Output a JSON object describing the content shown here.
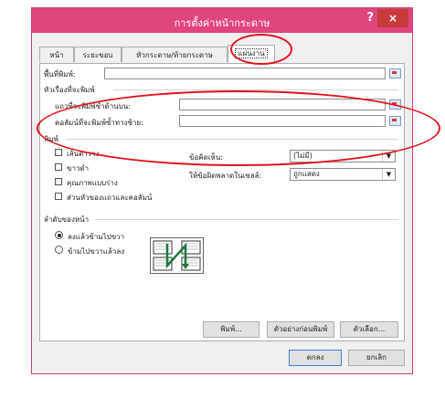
{
  "dialog": {
    "title": "การตั้งค่าหน้ากระดาษ",
    "help": "?",
    "close": "×"
  },
  "tabs": [
    {
      "label": "หน้า"
    },
    {
      "label": "ระยะขอบ"
    },
    {
      "label": "หัวกระดาษ/ท้ายกระดาษ"
    },
    {
      "label": "แผ่นงาน"
    }
  ],
  "sheet": {
    "print_area_label": "พื้นที่พิมพ์:",
    "print_titles_section": "หัวเรื่องที่จะพิมพ์",
    "rows_repeat_label": "แถวที่จะพิมพ์ซ้ำด้านบน:",
    "cols_repeat_label": "คอลัมน์ที่จะพิมพ์ซ้ำทางซ้าย:",
    "print_section": "พิมพ์",
    "checkboxes": [
      {
        "label": "เส้นตาราง"
      },
      {
        "label": "ขาวดำ"
      },
      {
        "label": "คุณภาพแบบร่าง"
      },
      {
        "label": "ส่วนหัวของแถวและคอลัมน์"
      }
    ],
    "comments_label": "ข้อคิดเห็น:",
    "comments_value": "(ไม่มี)",
    "errors_label": "ให้ข้อผิดพลาดในเซลล์:",
    "errors_value": "ถูกแสดง",
    "page_order_section": "ลำดับของหน้า",
    "radios": [
      {
        "label": "ลงแล้วข้ามไปขวา",
        "selected": true
      },
      {
        "label": "ข้ามไปขวาแล้วลง",
        "selected": false
      }
    ]
  },
  "buttons": {
    "print": "พิมพ์...",
    "preview": "ตัวอย่างก่อนพิมพ์",
    "options": "ตัวเลือก...",
    "ok": "ตกลง",
    "cancel": "ยกเลิก"
  },
  "colors": {
    "titlebar": "#e0457d",
    "annotation": "#e2121c"
  }
}
